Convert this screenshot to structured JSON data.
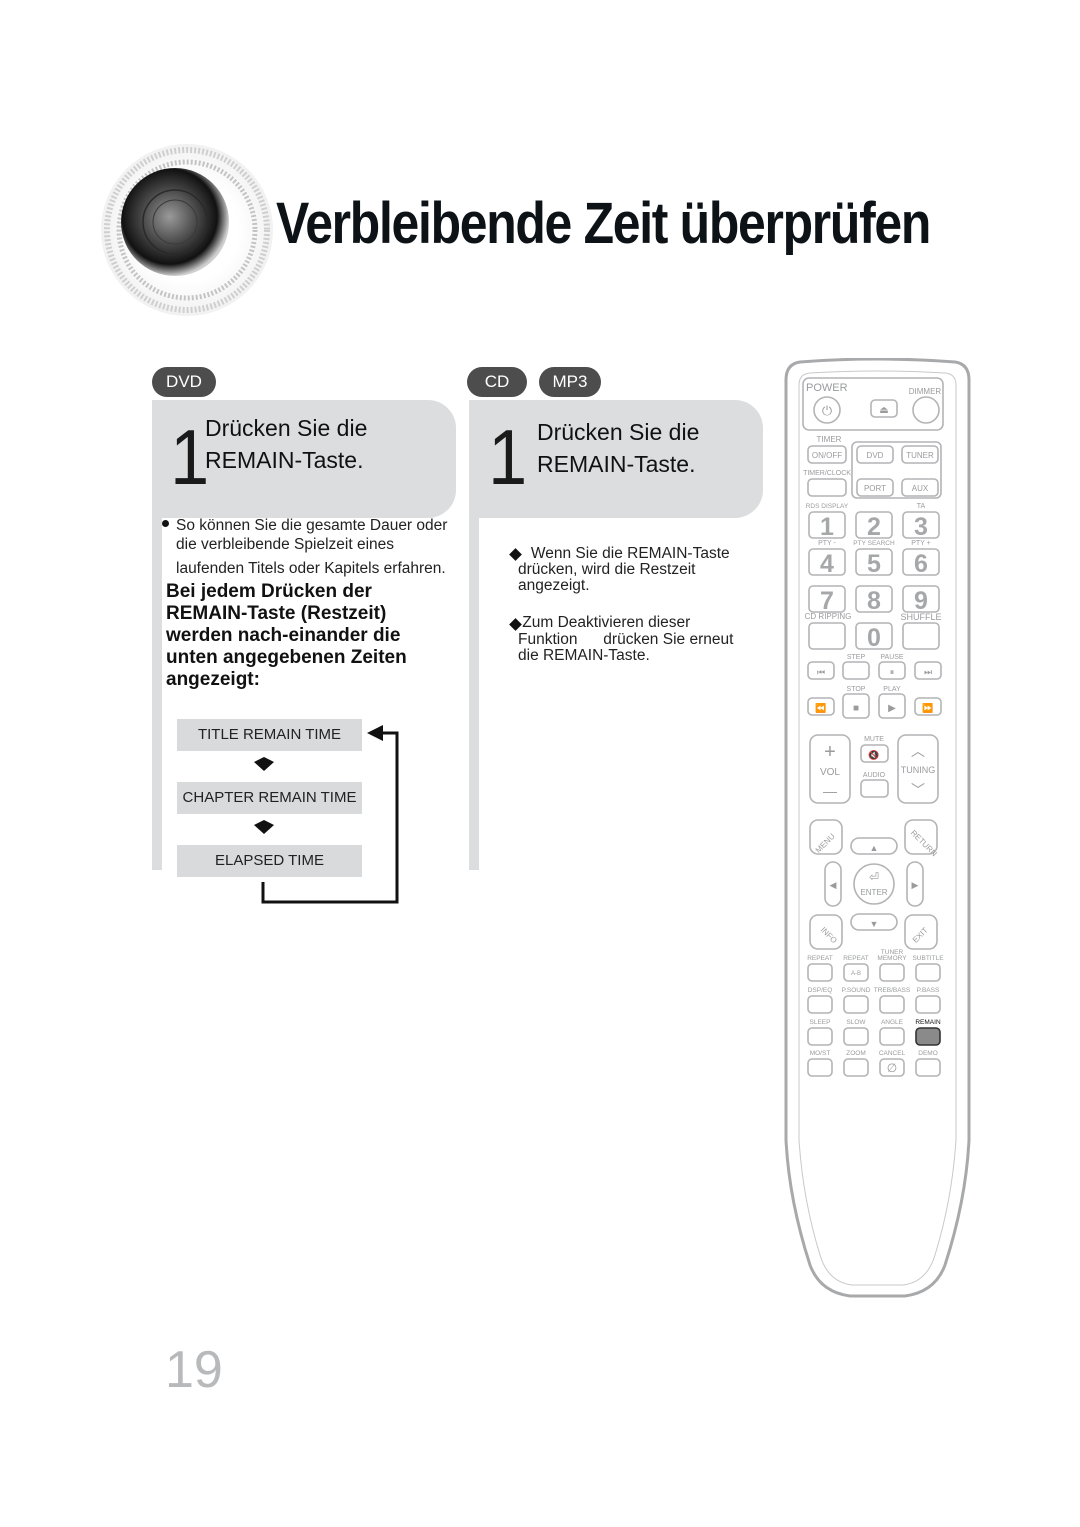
{
  "header": {
    "title": "Verbleibende Zeit überprüfen",
    "speaker_icon": "speaker-icon"
  },
  "left_section": {
    "mode_badge": "DVD",
    "step_number": "1",
    "step_line1": "Drücken Sie die",
    "step_line2": "REMAIN-Taste.",
    "description_lines": [
      "So können Sie die gesamte Dauer oder",
      "die verbleibende Spielzeit eines",
      "laufenden Titels oder Kapitels erfahren."
    ],
    "bold_lines": [
      "Bei jedem Drücken der",
      "REMAIN-Taste (Restzeit)",
      "werden nach-einander die",
      "unten angegebenen Zeiten",
      "angezeigt:"
    ],
    "flow": [
      "TITLE REMAIN TIME",
      "CHAPTER REMAIN TIME",
      "ELAPSED TIME"
    ]
  },
  "right_section": {
    "mode_badges": [
      "CD",
      "MP3"
    ],
    "step_number": "1",
    "step_line1": "Drücken Sie die",
    "step_line2": "REMAIN-Taste.",
    "notes": [
      [
        "   Wenn Sie die REMAIN-Taste",
        "drücken, wird die Restzeit",
        "angezeigt."
      ],
      [
        " Zum Deaktivieren dieser",
        "Funktion      drücken Sie erneut",
        "die REMAIN-Taste."
      ]
    ]
  },
  "remote": {
    "labels": {
      "power": "POWER",
      "dimmer": "DIMMER",
      "timer": "TIMER",
      "on_off": "ON/OFF",
      "dvd": "DVD",
      "tuner": "TUNER",
      "timer_clock": "TIMER/CLOCK",
      "port": "PORT",
      "aux": "AUX",
      "rds_display": "RDS DISPLAY",
      "ta": "TA",
      "pty_minus": "PTY -",
      "pty_search": "PTY SEARCH",
      "pty_plus": "PTY +",
      "cd_ripping": "CD RIPPING",
      "shuffle": "SHUFFLE",
      "step": "STEP",
      "pause": "PAUSE",
      "stop": "STOP",
      "play": "PLAY",
      "mute": "MUTE",
      "vol": "VOL",
      "audio": "AUDIO",
      "tuning": "TUNING",
      "menu": "MENU",
      "return": "RETURN",
      "enter": "ENTER",
      "info": "INFO",
      "exit": "EXIT",
      "tuner_memory_1": "TUNER",
      "tuner_memory_2": "MEMORY",
      "repeat": "REPEAT",
      "repeat_ab": "REPEAT",
      "ab": "A-B",
      "subtitle": "SUBTITLE",
      "dsp_eq": "DSP/EQ",
      "p_sound": "P.SOUND",
      "treb_bass": "TREB/BASS",
      "p_bass": "P.BASS",
      "sleep": "SLEEP",
      "slow": "SLOW",
      "angle": "ANGLE",
      "remain": "REMAIN",
      "mo_st": "MO/ST",
      "zoom": "ZOOM",
      "cancel": "CANCEL",
      "demo": "DEMO"
    },
    "digits": [
      "1",
      "2",
      "3",
      "4",
      "5",
      "6",
      "7",
      "8",
      "9",
      "0"
    ],
    "highlighted_button": "REMAIN",
    "highlight_color": "#8a8a8a"
  },
  "footer": {
    "page_number": "19"
  },
  "colors": {
    "panel": "#dcdddf",
    "badge": "#4d4d4d",
    "page_number": "#b8b9bb"
  }
}
